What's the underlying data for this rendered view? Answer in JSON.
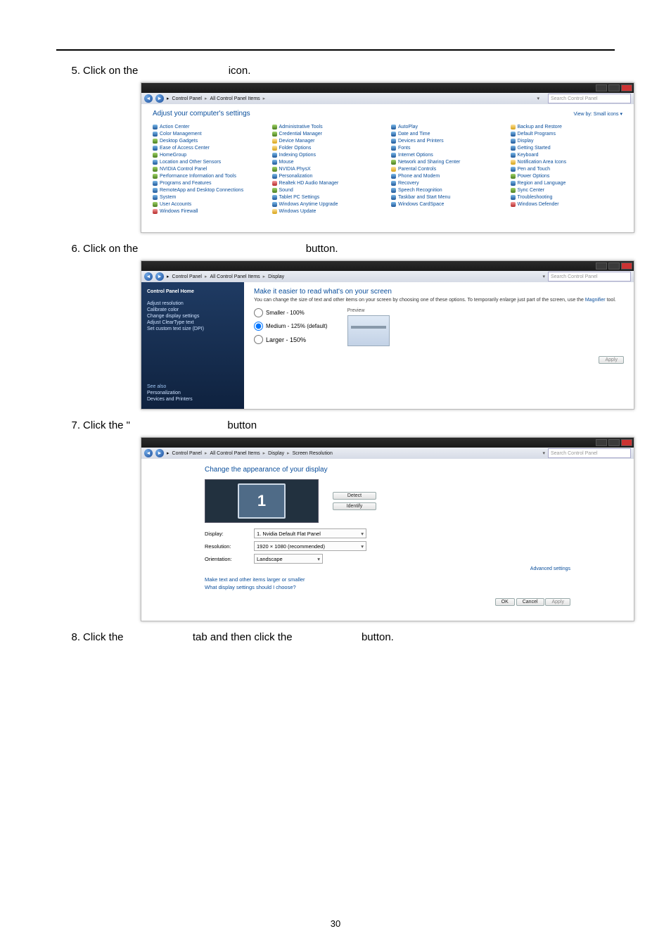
{
  "pageNumber": "30",
  "steps": {
    "s5": {
      "num": "5.",
      "text_pre": "Click on the ",
      "text_post": " icon."
    },
    "s6": {
      "num": "6.",
      "text_pre": "Click on the ",
      "text_post": " button."
    },
    "s7": {
      "num": "7.",
      "text_pre": "Click the \" ",
      "text_post": " button"
    },
    "s8": {
      "num": "8.",
      "text_pre": "Click the ",
      "text_mid": " tab and then click the ",
      "text_post": " button."
    }
  },
  "win1": {
    "breadcrumb": [
      "Control Panel",
      "All Control Panel Items"
    ],
    "search_placeholder": "Search Control Panel",
    "heading": "Adjust your computer's settings",
    "viewby": "View by:  Small icons ▾",
    "items": [
      "Action Center",
      "Administrative Tools",
      "AutoPlay",
      "Backup and Restore",
      "Color Management",
      "Credential Manager",
      "Date and Time",
      "Default Programs",
      "Desktop Gadgets",
      "Device Manager",
      "Devices and Printers",
      "Display",
      "Ease of Access Center",
      "Folder Options",
      "Fonts",
      "Getting Started",
      "HomeGroup",
      "Indexing Options",
      "Internet Options",
      "Keyboard",
      "Location and Other Sensors",
      "Mouse",
      "Network and Sharing Center",
      "Notification Area Icons",
      "NVIDIA Control Panel",
      "NVIDIA PhysX",
      "Parental Controls",
      "Pen and Touch",
      "Performance Information and Tools",
      "Personalization",
      "Phone and Modem",
      "Power Options",
      "Programs and Features",
      "Realtek HD Audio Manager",
      "Recovery",
      "Region and Language",
      "RemoteApp and Desktop Connections",
      "Sound",
      "Speech Recognition",
      "Sync Center",
      "System",
      "Tablet PC Settings",
      "Taskbar and Start Menu",
      "Troubleshooting",
      "User Accounts",
      "Windows Anytime Upgrade",
      "Windows CardSpace",
      "Windows Defender",
      "Windows Firewall",
      "Windows Update"
    ],
    "iconClasses": [
      "b",
      "g",
      "b",
      "y",
      "b",
      "g",
      "b",
      "b",
      "g",
      "y",
      "b",
      "b",
      "b",
      "y",
      "b",
      "b",
      "g",
      "b",
      "b",
      "b",
      "b",
      "b",
      "g",
      "y",
      "g",
      "g",
      "y",
      "b",
      "g",
      "b",
      "b",
      "g",
      "b",
      "r",
      "b",
      "b",
      "b",
      "g",
      "b",
      "g",
      "b",
      "b",
      "b",
      "b",
      "g",
      "b",
      "b",
      "r",
      "r",
      "y"
    ]
  },
  "win2": {
    "breadcrumb": [
      "Control Panel",
      "All Control Panel Items",
      "Display"
    ],
    "search_placeholder": "Search Control Panel",
    "side_home": "Control Panel Home",
    "side_links": [
      "Adjust resolution",
      "Calibrate color",
      "Change display settings",
      "Adjust ClearType text",
      "Set custom text size (DPI)"
    ],
    "see_also_hdr": "See also",
    "see_also": [
      "Personalization",
      "Devices and Printers"
    ],
    "heading": "Make it easier to read what's on your screen",
    "note_pre": "You can change the size of text and other items on your screen by choosing one of these options. To temporarily enlarge just part of the screen, use the ",
    "note_link": "Magnifier",
    "note_post": " tool.",
    "radios": [
      "Smaller - 100%",
      "Medium - 125% (default)",
      "Larger - 150%"
    ],
    "preview_label": "Preview",
    "apply": "Apply"
  },
  "win3": {
    "breadcrumb": [
      "Control Panel",
      "All Control Panel Items",
      "Display",
      "Screen Resolution"
    ],
    "search_placeholder": "Search Control Panel",
    "heading": "Change the appearance of your display",
    "monitor_number": "1",
    "detect": "Detect",
    "identify": "Identify",
    "labels": {
      "display": "Display:",
      "resolution": "Resolution:",
      "orientation": "Orientation:"
    },
    "values": {
      "display": "1. Nvidia Default Flat Panel",
      "resolution": "1920 × 1080 (recommended)",
      "orientation": "Landscape"
    },
    "adv": "Advanced settings",
    "link1": "Make text and other items larger or smaller",
    "link2": "What display settings should I choose?",
    "ok": "OK",
    "cancel": "Cancel",
    "apply": "Apply"
  }
}
